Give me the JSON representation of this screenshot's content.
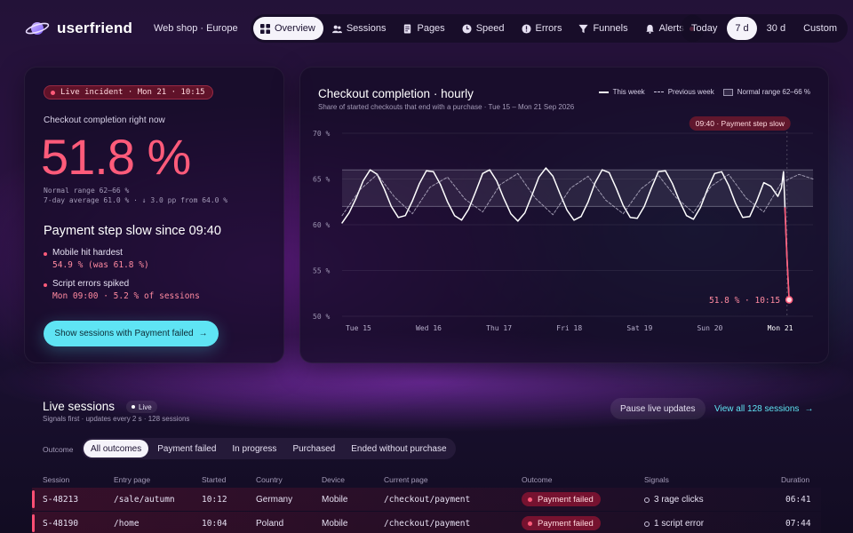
{
  "app": {
    "brand": "userfriend",
    "workspace": "Web shop · Europe"
  },
  "nav": [
    {
      "label": "Overview",
      "icon": "grid-icon",
      "active": true
    },
    {
      "label": "Sessions",
      "icon": "users-icon"
    },
    {
      "label": "Pages",
      "icon": "page-icon"
    },
    {
      "label": "Speed",
      "icon": "clock-icon"
    },
    {
      "label": "Errors",
      "icon": "error-icon"
    },
    {
      "label": "Funnels",
      "icon": "funnel-icon"
    },
    {
      "label": "Alerts",
      "icon": "bell-icon",
      "has_dot": true
    }
  ],
  "range": {
    "options": [
      "Today",
      "7 d",
      "30 d",
      "Custom"
    ],
    "selected": "7 d"
  },
  "incident": {
    "badge": "Live incident · Mon 21 · 10:15",
    "kpi_label": "Checkout completion right now",
    "kpi_value": "51.8 %",
    "normal_range": "Normal range 62–66 %",
    "average": "7-day average 61.0 % · ↓ 3.0 pp from 64.0 %",
    "headline": "Payment step slow since 09:40",
    "findings": [
      {
        "title": "Mobile hit hardest",
        "detail": "54.9 % (was 61.8 %)"
      },
      {
        "title": "Script errors spiked",
        "detail": "Mon 09:00 · 5.2 % of sessions"
      }
    ],
    "cta": "Show sessions with Payment failed",
    "cta_arrow": "→"
  },
  "chart_panel": {
    "title": "Checkout completion · hourly",
    "subtitle": "Share of started checkouts that end with a purchase · Tue 15 – Mon 21 Sep 2026",
    "legend": {
      "this_week": "This week",
      "previous_week": "Previous week",
      "normal_range": "Normal range 62–66 %"
    },
    "annotation": "09:40 · Payment step slow",
    "end_label": "51.8 % · 10:15"
  },
  "chart_data": {
    "type": "line",
    "title": "Checkout completion · hourly",
    "subtitle": "Share of started checkouts that end with a purchase · Tue 15 – Mon 21 Sep 2026",
    "ylim": [
      50,
      70
    ],
    "y_ticks": [
      "70 %",
      "65 %",
      "60 %",
      "55 %",
      "50 %"
    ],
    "y_tick_values": [
      70,
      65,
      60,
      55,
      50
    ],
    "x_ticks": [
      "Tue 15",
      "Wed 16",
      "Thu 17",
      "Fri 18",
      "Sat 19",
      "Sun 20",
      "Mon 21"
    ],
    "x_range_days": [
      0,
      6.7
    ],
    "normal_range": [
      62,
      66
    ],
    "grid": true,
    "legend_position": "top-right",
    "series": [
      {
        "name": "This week",
        "style": "solid",
        "x_days": [
          0,
          0.1,
          0.2,
          0.3,
          0.4,
          0.5,
          0.6,
          0.7,
          0.8,
          0.9,
          1,
          1.1,
          1.2,
          1.3,
          1.4,
          1.5,
          1.6,
          1.7,
          1.8,
          1.9,
          2,
          2.1,
          2.2,
          2.3,
          2.4,
          2.5,
          2.6,
          2.7,
          2.8,
          2.9,
          3,
          3.1,
          3.2,
          3.3,
          3.4,
          3.5,
          3.6,
          3.7,
          3.8,
          3.9,
          4,
          4.1,
          4.2,
          4.3,
          4.4,
          4.5,
          4.6,
          4.7,
          4.8,
          4.9,
          5,
          5.1,
          5.2,
          5.3,
          5.4,
          5.5,
          5.6,
          5.7,
          5.8,
          5.9,
          6,
          6.1,
          6.2,
          6.25,
          6.28,
          6.3,
          6.33,
          6.36
        ],
        "values": [
          60.2,
          61.3,
          62.9,
          64.8,
          66.0,
          65.5,
          63.9,
          62.0,
          60.8,
          61.0,
          62.6,
          64.5,
          65.9,
          65.8,
          64.4,
          62.5,
          61.0,
          60.5,
          61.7,
          63.6,
          65.6,
          66.0,
          64.8,
          62.9,
          61.2,
          60.4,
          61.3,
          63.2,
          65.2,
          66.2,
          65.3,
          63.4,
          61.6,
          60.5,
          60.9,
          62.5,
          64.6,
          66.0,
          65.7,
          64.0,
          62.1,
          60.8,
          60.7,
          62.0,
          64.0,
          65.8,
          65.9,
          64.5,
          62.6,
          61.0,
          60.6,
          61.9,
          63.9,
          65.6,
          65.8,
          64.3,
          62.3,
          60.8,
          60.9,
          62.6,
          64.6,
          64.2,
          63.1,
          64.0,
          65.8,
          61.9,
          56.4,
          51.8
        ]
      },
      {
        "name": "Previous week",
        "style": "dashed",
        "x_days": [
          0,
          0.25,
          0.5,
          0.75,
          1,
          1.25,
          1.5,
          1.75,
          2,
          2.25,
          2.5,
          2.75,
          3,
          3.25,
          3.5,
          3.75,
          4,
          4.25,
          4.5,
          4.75,
          5,
          5.25,
          5.5,
          5.75,
          6,
          6.25,
          6.5,
          6.7
        ],
        "values": [
          61.0,
          63.8,
          65.5,
          63.0,
          61.2,
          64.1,
          65.2,
          62.8,
          61.4,
          64.4,
          65.6,
          62.9,
          61.1,
          64.0,
          65.3,
          62.7,
          61.2,
          63.9,
          65.4,
          63.0,
          61.3,
          64.2,
          65.5,
          62.9,
          61.4,
          64.6,
          65.5,
          65.0
        ]
      }
    ],
    "annotation_time_days": 6.33,
    "end_point": {
      "x_days": 6.36,
      "value": 51.8,
      "label": "51.8 % · 10:15"
    }
  },
  "live": {
    "title": "Live sessions",
    "badge": "Live",
    "subtitle": "Signals first · updates every 2 s · 128 sessions",
    "pause": "Pause live updates",
    "view_all": "View all 128 sessions",
    "view_all_arrow": "→",
    "filter_label": "Outcome",
    "filters": [
      "All outcomes",
      "Payment failed",
      "In progress",
      "Purchased",
      "Ended without purchase"
    ],
    "columns": [
      "Session",
      "Entry page",
      "Started",
      "Country",
      "Device",
      "Current page",
      "Outcome",
      "Signals",
      "Duration"
    ],
    "rows": [
      {
        "session": "S-48213",
        "entry": "/sale/autumn",
        "started": "10:12",
        "country": "Germany",
        "device": "Mobile",
        "current": "/checkout/payment",
        "outcome": "Payment failed",
        "signal": "3 rage clicks",
        "duration": "06:41"
      },
      {
        "session": "S-48190",
        "entry": "/home",
        "started": "10:04",
        "country": "Poland",
        "device": "Mobile",
        "current": "/checkout/payment",
        "outcome": "Payment failed",
        "signal": "1 script error",
        "duration": "07:44"
      }
    ]
  },
  "colors": {
    "accent": "#5fe4f4",
    "alert": "#ff5b7a",
    "background": "#1a1030"
  }
}
